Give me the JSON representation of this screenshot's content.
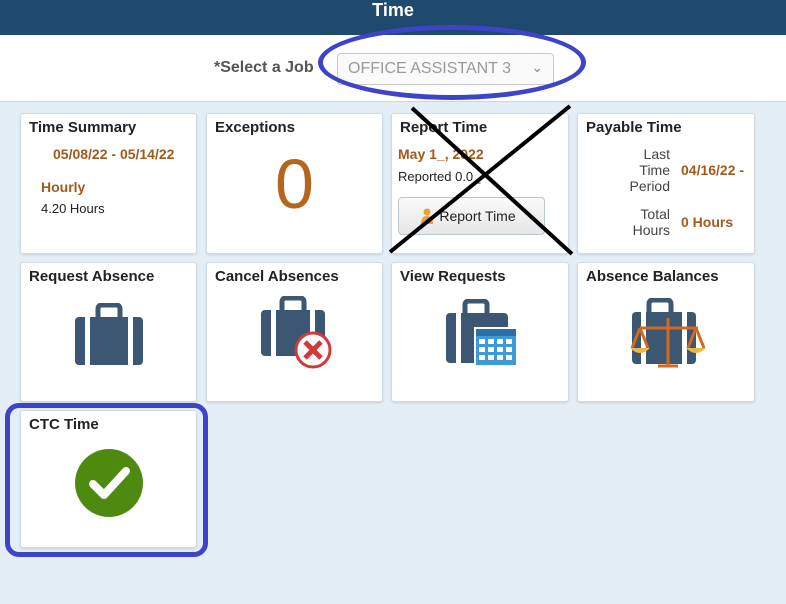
{
  "header": {
    "title": "Time"
  },
  "job": {
    "label": "*Select a Job",
    "selected": "OFFICE ASSISTANT 3"
  },
  "tiles": {
    "time_summary": {
      "title": "Time Summary",
      "range": "05/08/22 - 05/14/22",
      "type": "Hourly",
      "hours": "4.20 Hours"
    },
    "exceptions": {
      "title": "Exceptions",
      "count": "0"
    },
    "report_time": {
      "title": "Report Time",
      "date": "May 1_, 2022",
      "reported": "Reported 0.0_",
      "button": "Report Time"
    },
    "payable_time": {
      "title": "Payable Time",
      "period_label": "Last Time Period",
      "period_value": "04/16/22 -",
      "total_label": "Total Hours",
      "total_value": "0 Hours"
    },
    "request_absence": {
      "title": "Request Absence"
    },
    "cancel_absences": {
      "title": "Cancel Absences"
    },
    "view_requests": {
      "title": "View Requests"
    },
    "absence_balances": {
      "title": "Absence Balances"
    },
    "ctc_time": {
      "title": "CTC Time"
    }
  },
  "colors": {
    "header": "#1f4a6d",
    "accent_orange": "#b5651d",
    "annotation_blue": "#3d44c8",
    "check_green": "#4f8a10",
    "briefcase": "#3b5774"
  }
}
